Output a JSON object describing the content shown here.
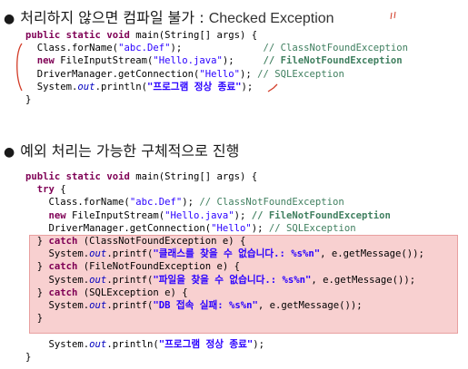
{
  "section1": {
    "bullet": "●",
    "heading_ko": "처리하지 않으면 컴파일 불가 : ",
    "heading_en": "Checked Exception",
    "code": {
      "sig_public": "public",
      "sig_static": "static",
      "sig_void": "void",
      "sig_rest": " main(String[] args) {",
      "l1_code": "Class.forName(",
      "l1_str": "\"abc.Def\"",
      "l1_end": ");",
      "l1_cmt": "// ClassNotFoundException",
      "l2_new": "new",
      "l2_code": " FileInputStream(",
      "l2_str": "\"Hello.java\"",
      "l2_end": ");",
      "l2_cmt": "// FileNotFoundException",
      "l3_code": "DriverManager.getConnection(",
      "l3_str": "\"Hello\"",
      "l3_end": "); ",
      "l3_cmt": "// SQLException",
      "l4_sys": "System.",
      "l4_out": "out",
      "l4_println": ".println(",
      "l4_str": "\"프로그램 정상 종료\"",
      "l4_end": ");",
      "close": "}"
    }
  },
  "section2": {
    "bullet": "●",
    "heading": "예외 처리는 가능한 구체적으로 진행",
    "code": {
      "sig_public": "public",
      "sig_static": "static",
      "sig_void": "void",
      "sig_rest": " main(String[] args) {",
      "try_kw": "try",
      "try_brace": " {",
      "l1_code": "Class.forName(",
      "l1_str": "\"abc.Def\"",
      "l1_end": "); ",
      "l1_cmt": "// ClassNotFoundException",
      "l2_new": "new",
      "l2_code": " FileInputStream(",
      "l2_str": "\"Hello.java\"",
      "l2_end": "); ",
      "l2_cmt": "// FileNotFoundException",
      "l3_code": "DriverManager.getConnection(",
      "l3_str": "\"Hello\"",
      "l3_end": "); ",
      "l3_cmt": "// SQLException",
      "c1_open": "} ",
      "c1_kw": "catch",
      "c1_rest": " (ClassNotFoundException e) {",
      "c1_sys": "System.",
      "c1_out": "out",
      "c1_printf": ".printf(",
      "c1_str": "\"클래스를 찾을 수 없습니다.: %s%n\"",
      "c1_end": ", e.getMessage());",
      "c2_open": "} ",
      "c2_kw": "catch",
      "c2_rest": " (FileNotFoundException e) {",
      "c2_sys": "System.",
      "c2_out": "out",
      "c2_printf": ".printf(",
      "c2_str": "\"파일을 찾을 수 없습니다.: %s%n\"",
      "c2_end": ", e.getMessage());",
      "c3_open": "} ",
      "c3_kw": "catch",
      "c3_rest": " (SQLException e) {",
      "c3_sys": "System.",
      "c3_out": "out",
      "c3_printf": ".printf(",
      "c3_str": "\"DB 접속 실패: %s%n\"",
      "c3_end": ", e.getMessage());",
      "c_close": "}",
      "l4_sys": "System.",
      "l4_out": "out",
      "l4_println": ".println(",
      "l4_str": "\"프로그램 정상 종료\"",
      "l4_end": ");",
      "close": "}"
    }
  },
  "colors": {
    "keyword": "#7f0055",
    "string": "#2a00ff",
    "field": "#0000c0",
    "comment": "#3f7f5f",
    "catch_highlight": "#f8d0d0",
    "annotation": "#d23c28"
  }
}
